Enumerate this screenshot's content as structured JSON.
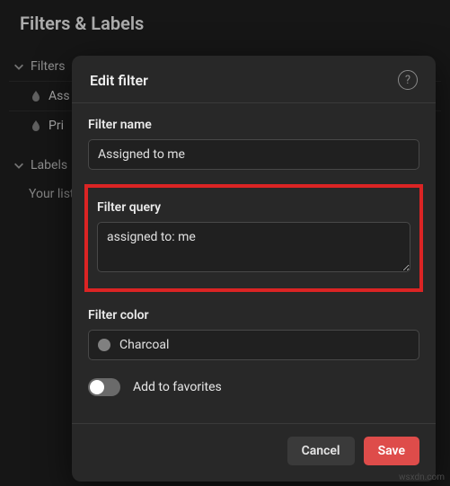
{
  "page": {
    "title": "Filters & Labels",
    "sections": {
      "filters": {
        "label": "Filters",
        "items": [
          "Ass",
          "Pri"
        ]
      },
      "labels": {
        "label": "Labels",
        "empty_message": "Your list"
      }
    }
  },
  "modal": {
    "title": "Edit filter",
    "help_glyph": "?",
    "name_label": "Filter name",
    "name_value": "Assigned to me",
    "query_label": "Filter query",
    "query_value": "assigned to: me",
    "color_label": "Filter color",
    "color_name": "Charcoal",
    "color_hex": "#808080",
    "favorites_label": "Add to favorites",
    "favorites_on": false,
    "cancel_label": "Cancel",
    "save_label": "Save"
  },
  "watermark": "wsxdn.com"
}
